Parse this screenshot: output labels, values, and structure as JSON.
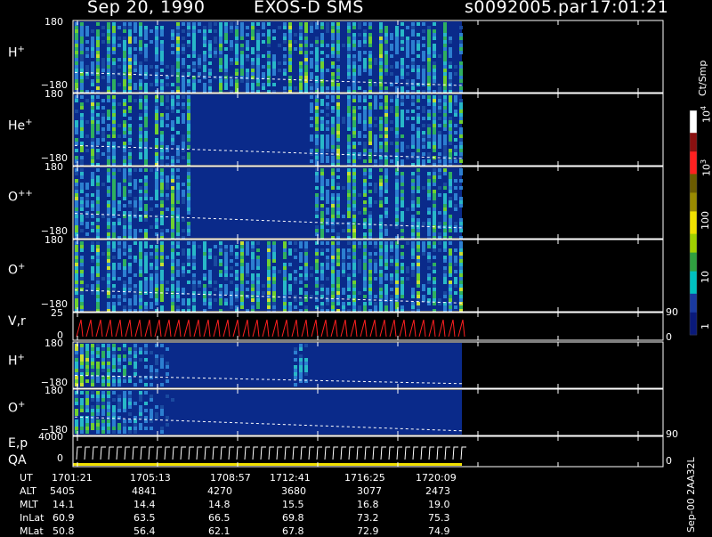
{
  "header": {
    "date": "Sep 20, 1990",
    "instrument": "EXOS-D SMS",
    "file": "s0092005.par",
    "time": "17:01:21"
  },
  "colorbar": {
    "unit": "Ct/Smp",
    "ticks": [
      "1",
      "10",
      "100",
      "10",
      "10"
    ],
    "tick_exponents": [
      "",
      "",
      "",
      "3",
      "4"
    ]
  },
  "stamp": "Sep-00  2AA32L",
  "panels": {
    "p1": {
      "label": "H",
      "charge": "+",
      "ytop": "180",
      "ybot": "−180"
    },
    "p2": {
      "label": "He",
      "charge": "+",
      "ytop": "180",
      "ybot": "−180"
    },
    "p3": {
      "label": "O",
      "charge": "++",
      "ytop": "180",
      "ybot": "−180"
    },
    "p4": {
      "label": "O",
      "charge": "+",
      "ytop": "180",
      "ybot": "−180"
    },
    "p5": {
      "label": "V,r",
      "ytop": "25",
      "ybot": "0",
      "rtop": "90",
      "rbot": "0"
    },
    "p6": {
      "label": "H",
      "charge": "+",
      "ytop": "180",
      "ybot": "−180"
    },
    "p7": {
      "label": "O",
      "charge": "+",
      "ytop": "180",
      "ybot": "−180"
    },
    "p8": {
      "label": "E,p",
      "label2": "QA",
      "ytop": "4000",
      "ybot": "0",
      "rtop": "90",
      "rbot": "0"
    }
  },
  "footer": {
    "row_labels": [
      "UT",
      "ALT",
      "MLT",
      "InLat",
      "MLat"
    ],
    "columns": [
      {
        "UT": "1701:21",
        "ALT": "5405",
        "MLT": "14.1",
        "InLat": "60.9",
        "MLat": "50.8"
      },
      {
        "UT": "1705:13",
        "ALT": "4841",
        "MLT": "14.4",
        "InLat": "63.5",
        "MLat": "56.4"
      },
      {
        "UT": "1708:57",
        "ALT": "4270",
        "MLT": "14.8",
        "InLat": "66.5",
        "MLat": "62.1"
      },
      {
        "UT": "1712:41",
        "ALT": "3680",
        "MLT": "15.5",
        "InLat": "69.8",
        "MLat": "67.8"
      },
      {
        "UT": "1716:25",
        "ALT": "3077",
        "MLT": "16.8",
        "InLat": "73.2",
        "MLat": "72.9"
      },
      {
        "UT": "1720:09",
        "ALT": "2473",
        "MLT": "19.0",
        "InLat": "75.3",
        "MLat": "74.9"
      }
    ]
  },
  "chart_data": {
    "type": "heatmap",
    "x_ticks": [
      "1701:21",
      "1705:13",
      "1708:57",
      "1712:41",
      "1716:25",
      "1720:09"
    ],
    "colorbar_scale": "log",
    "colorbar_range": [
      1,
      10000
    ],
    "panels": [
      {
        "name": "H+",
        "ylim": [
          -180,
          180
        ]
      },
      {
        "name": "He+",
        "ylim": [
          -180,
          180
        ]
      },
      {
        "name": "O++",
        "ylim": [
          -180,
          180
        ]
      },
      {
        "name": "O+",
        "ylim": [
          -180,
          180
        ]
      },
      {
        "name": "V,r",
        "ylim": [
          0,
          25
        ],
        "right_ylim": [
          0,
          90
        ]
      },
      {
        "name": "H+",
        "ylim": [
          -180,
          180
        ]
      },
      {
        "name": "O+",
        "ylim": [
          -180,
          180
        ]
      },
      {
        "name": "E,p / QA",
        "ylim": [
          0,
          4000
        ],
        "right_ylim": [
          0,
          90
        ]
      }
    ],
    "colors": {
      "background": "#000000",
      "fill": "#0a2a8a",
      "dashed_trace": "#ffffff",
      "vr_trace": "#ff2020",
      "qa_bar": "#f0e000"
    }
  }
}
